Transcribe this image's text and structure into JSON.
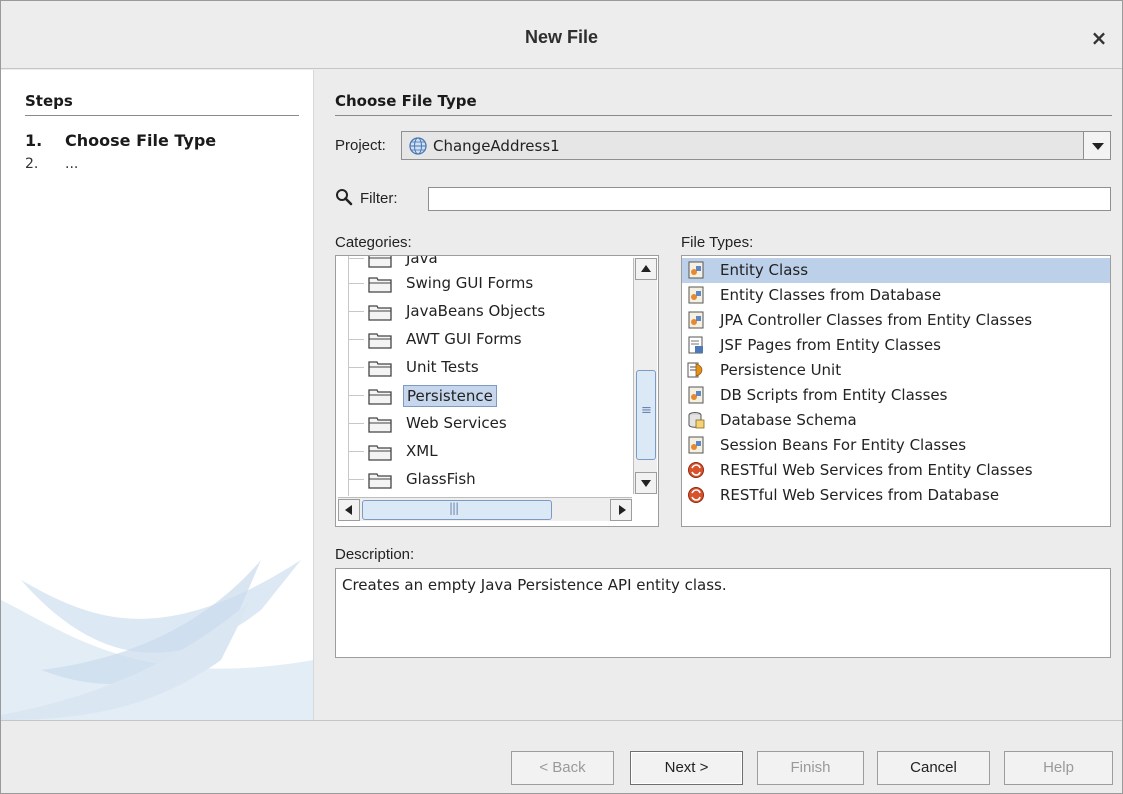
{
  "dialog": {
    "title": "New File"
  },
  "steps": {
    "heading": "Steps",
    "items": [
      {
        "num": "1.",
        "label": "Choose File Type"
      },
      {
        "num": "2.",
        "label": "..."
      }
    ]
  },
  "main": {
    "heading": "Choose File Type",
    "project_label": "Project:",
    "project_value": "ChangeAddress1",
    "filter_label": "Filter:",
    "filter_value": "",
    "categories_label": "Categories:",
    "categories": [
      {
        "label": "Java"
      },
      {
        "label": "Swing GUI Forms"
      },
      {
        "label": "JavaBeans Objects"
      },
      {
        "label": "AWT GUI Forms"
      },
      {
        "label": "Unit Tests"
      },
      {
        "label": "Persistence",
        "selected": true
      },
      {
        "label": "Web Services"
      },
      {
        "label": "XML"
      },
      {
        "label": "GlassFish"
      }
    ],
    "file_types_label": "File Types:",
    "file_types": [
      {
        "label": "Entity Class",
        "icon": "entity-class-icon",
        "selected": true
      },
      {
        "label": "Entity Classes from Database",
        "icon": "entity-class-icon"
      },
      {
        "label": "JPA Controller Classes from Entity Classes",
        "icon": "entity-class-icon"
      },
      {
        "label": "JSF Pages from Entity Classes",
        "icon": "jsf-page-icon"
      },
      {
        "label": "Persistence Unit",
        "icon": "persistence-unit-icon"
      },
      {
        "label": "DB Scripts from Entity Classes",
        "icon": "entity-class-icon"
      },
      {
        "label": "Database Schema",
        "icon": "database-schema-icon"
      },
      {
        "label": "Session Beans For Entity Classes",
        "icon": "entity-class-icon"
      },
      {
        "label": "RESTful Web Services from Entity Classes",
        "icon": "rest-service-icon"
      },
      {
        "label": "RESTful Web Services from Database",
        "icon": "rest-service-icon"
      }
    ],
    "description_label": "Description:",
    "description": "Creates an empty Java Persistence API entity class."
  },
  "buttons": {
    "back": "< Back",
    "next": "Next >",
    "finish": "Finish",
    "cancel": "Cancel",
    "help": "Help"
  },
  "colors": {
    "selection": "#bcd0ea",
    "tree_selection": "#c6d6ec"
  }
}
